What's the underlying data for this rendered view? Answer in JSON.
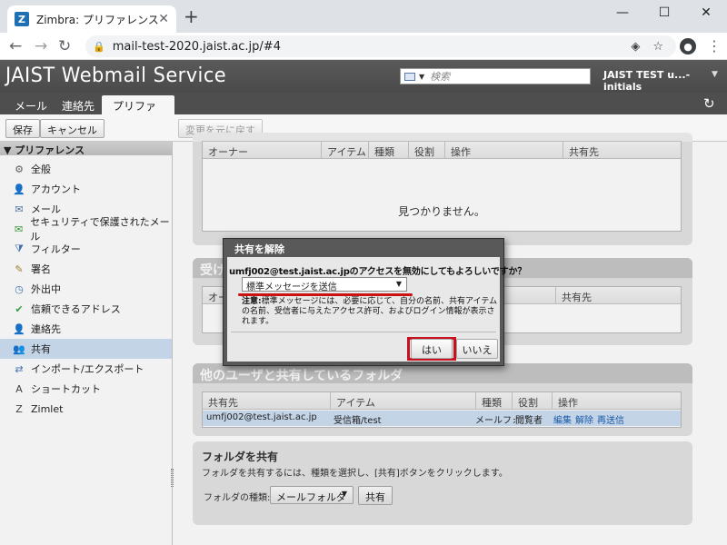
{
  "browser": {
    "tab_title": "Zimbra: プリファレンス: 共有",
    "favicon_letter": "Z",
    "url": "mail-test-2020.jaist.ac.jp/#4",
    "window_controls": [
      "—",
      "☐",
      "✕"
    ]
  },
  "app": {
    "logo": "JAIST Webmail Service",
    "search_placeholder": "検索",
    "user": "JAIST TEST u...-initials",
    "tabs": [
      {
        "label": "メール",
        "active": false
      },
      {
        "label": "連絡先",
        "active": false
      },
      {
        "label": "プリファレンス",
        "active": true
      }
    ]
  },
  "toolbar": {
    "save": "保存",
    "cancel": "キャンセル",
    "revert": "変更を元に戻す"
  },
  "sidebar": {
    "header": "プリファレンス",
    "items": [
      {
        "label": "全般",
        "icon": "gear-icon",
        "glyph": "⚙"
      },
      {
        "label": "アカウント",
        "icon": "account-icon",
        "glyph": "👤"
      },
      {
        "label": "メール",
        "icon": "mail-icon",
        "glyph": "✉"
      },
      {
        "label": "セキュリティで保護されたメール",
        "icon": "secure-mail-icon",
        "glyph": "✉"
      },
      {
        "label": "フィルター",
        "icon": "filter-icon",
        "glyph": "⧩"
      },
      {
        "label": "署名",
        "icon": "signature-icon",
        "glyph": "✎"
      },
      {
        "label": "外出中",
        "icon": "out-of-office-icon",
        "glyph": "◷"
      },
      {
        "label": "信頼できるアドレス",
        "icon": "trusted-shield-icon",
        "glyph": "✔"
      },
      {
        "label": "連絡先",
        "icon": "contacts-icon",
        "glyph": "👤"
      },
      {
        "label": "共有",
        "icon": "sharing-icon",
        "glyph": "👥"
      },
      {
        "label": "インポート/エクスポート",
        "icon": "import-export-icon",
        "glyph": "⇄"
      },
      {
        "label": "ショートカット",
        "icon": "shortcut-icon",
        "glyph": "A"
      },
      {
        "label": "Zimlet",
        "icon": "zimlet-icon",
        "glyph": "Z"
      }
    ],
    "selected_index": 9
  },
  "shared_with_me": {
    "columns": [
      "オーナー",
      "アイテム",
      "種類",
      "役割",
      "操作",
      "共有先"
    ],
    "empty_text": "見つかりません。"
  },
  "accepted_shares": {
    "title": "受け",
    "columns": [
      "オー",
      "共有先"
    ]
  },
  "shared_by_me": {
    "title": "他のユーザと共有しているフォルダ",
    "columns": [
      "共有先",
      "アイテム",
      "種類",
      "役割",
      "操作"
    ],
    "row": {
      "share_with": "umfj002@test.jaist.ac.jp",
      "item": "受信箱/test",
      "type": "メールフォル",
      "role": "閲覧者",
      "actions": [
        "編集",
        "解除",
        "再送信"
      ]
    }
  },
  "share_folder": {
    "title": "フォルダを共有",
    "description": "フォルダを共有するには、種類を選択し、[共有]ボタンをクリックします。",
    "type_label": "フォルダの種類:",
    "type_value": "メールフォルダ",
    "share_button": "共有"
  },
  "dialog": {
    "title": "共有を解除",
    "question": "umfj002@test.jaist.ac.jpのアクセスを無効にしてもよろしいですか？",
    "message_option": "標準メッセージを送信",
    "note_label": "注意:",
    "note_text": "標準メッセージには、必要に応じて、自分の名前、共有アイテムの名前、受信者に与えたアクセス許可、およびログイン情報が表示されます。",
    "yes": "はい",
    "no": "いいえ"
  }
}
